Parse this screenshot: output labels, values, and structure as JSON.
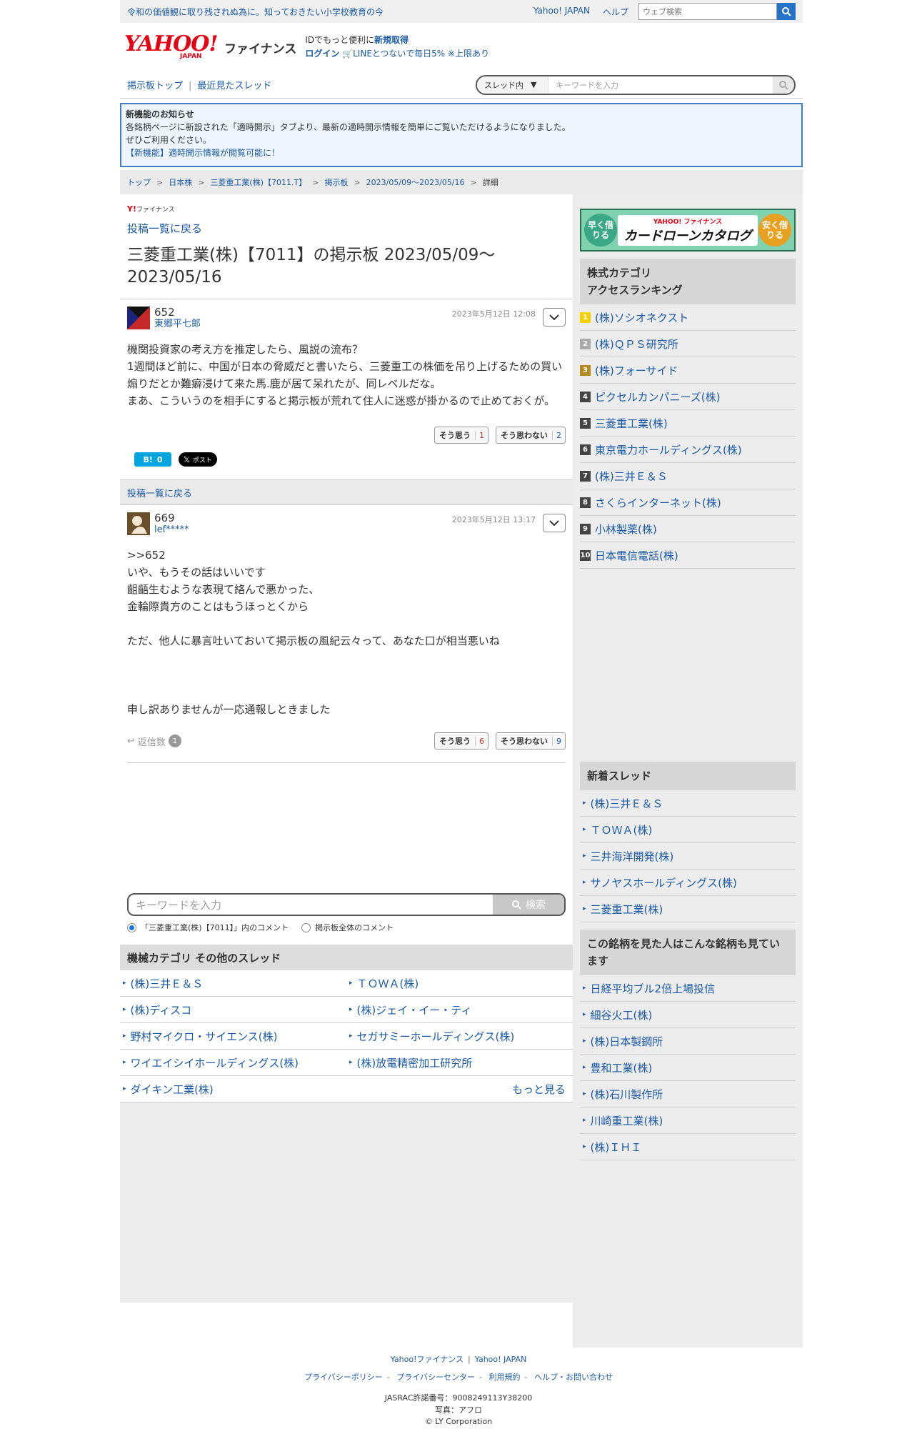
{
  "topbar": {
    "promo": "令和の価値観に取り残されぬ為に。知っておきたい小学校教育の今",
    "links": [
      "Yahoo! JAPAN",
      "ヘルプ"
    ],
    "search_placeholder": "ウェブ検索"
  },
  "header": {
    "logo_main": "YAHOO!",
    "logo_sub": "JAPAN",
    "finance": "ファイナンス",
    "line1_prefix": "IDでもっと便利に",
    "line1_link": "新規取得",
    "login": "ログイン",
    "line2": "LINEとつないで毎日5% ※上限あり"
  },
  "nav": {
    "top": "掲示板トップ",
    "recent": "最近見たスレッド",
    "scope": "スレッド内",
    "placeholder": "キーワードを入力"
  },
  "notice": {
    "title": "新機能のお知らせ",
    "line1": "各銘柄ページに新設された「適時開示」タブより、最新の適時開示情報を簡単にご覧いただけるようになりました。",
    "line2": "ぜひご利用ください。",
    "link": "【新機能】適時開示情報が閲覧可能に！"
  },
  "breadcrumb": [
    "トップ",
    "日本株",
    "三菱重工業(株)【7011.T】",
    "掲示板",
    "2023/05/09〜2023/05/16",
    "詳細"
  ],
  "main": {
    "brand_small": "ファイナンス",
    "back": "投稿一覧に戻る",
    "title": "三菱重工業(株)【7011】の掲示板 2023/05/09〜2023/05/16",
    "posts": [
      {
        "num": "652",
        "user": "東郷平七郎",
        "date": "2023年5月12日 12:08",
        "body": "機関投資家の考え方を推定したら、風説の流布？\n1週間ほど前に、中国が日本の脅威だと書いたら、三菱重工の株価を吊り上げるための買い煽りだとか難癖浸けて来た馬.鹿が居て呆れたが、同レベルだな。\nまあ、こういうのを相手にすると掲示板が荒れて住人に迷惑が掛かるので止めておくが。",
        "agree": "そう思う",
        "agree_count": "1",
        "disagree": "そう思わない",
        "disagree_count": "2"
      },
      {
        "num": "669",
        "user": "lef*****",
        "date": "2023年5月12日 13:17",
        "body": ">>652\nいや、もうその話はいいです\n齟齬生むような表現て絡んで悪かった、\n金輪際貴方のことはもうほっとくから\n\nただ、他人に暴言吐いておいて掲示板の風紀云々って、あなた口が相当悪いね\n\n\n\n申し訳ありませんが一応通報しときました",
        "agree": "そう思う",
        "agree_count": "6",
        "disagree": "そう思わない",
        "disagree_count": "9",
        "reply_label": "返信数",
        "reply_count": "1"
      }
    ],
    "hatena_count": "0",
    "x_label": "ポスト",
    "keyword_placeholder": "キーワードを入力",
    "search_button": "検索",
    "radio1": "「三菱重工業(株)【7011】」内のコメント",
    "radio2": "掲示板全体のコメント",
    "category_title": "機械カテゴリ その他のスレッド",
    "category_items": [
      "(株)三井Ｅ＆Ｓ",
      "ＴＯＷＡ(株)",
      "(株)ディスコ",
      "(株)ジェイ・イー・ティ",
      "野村マイクロ・サイエンス(株)",
      "セガサミーホールディングス(株)",
      "ワイエイシイホールディングス(株)",
      "(株)放電精密加工研究所",
      "ダイキン工業(株)"
    ],
    "more": "もっと見る"
  },
  "side": {
    "banner_left": "早く借りる",
    "banner_brand": "YAHOO! ファイナンス",
    "banner_title": "カードローンカタログ",
    "banner_right": "安く借りる",
    "ranking_title": "株式カテゴリ\nアクセスランキング",
    "ranking": [
      "(株)ソシオネクスト",
      "(株)ＱＰＳ研究所",
      "(株)フォーサイド",
      "ピクセルカンパニーズ(株)",
      "三菱重工業(株)",
      "東京電力ホールディングス(株)",
      "(株)三井Ｅ＆Ｓ",
      "さくらインターネット(株)",
      "小林製薬(株)",
      "日本電信電話(株)"
    ],
    "new_title": "新着スレッド",
    "new_threads": [
      "(株)三井Ｅ＆Ｓ",
      "ＴＯＷＡ(株)",
      "三井海洋開発(株)",
      "サノヤスホールディングス(株)",
      "三菱重工業(株)"
    ],
    "also_title": "この銘柄を見た人はこんな銘柄も見ています",
    "also": [
      "日経平均ブル2倍上場投信",
      "細谷火工(株)",
      "(株)日本製鋼所",
      "豊和工業(株)",
      "(株)石川製作所",
      "川崎重工業(株)",
      "(株)ＩＨＩ"
    ]
  },
  "footer": {
    "row1": [
      "Yahoo!ファイナンス",
      "Yahoo! JAPAN"
    ],
    "row2": [
      "プライバシーポリシー",
      "プライバシーセンター",
      "利用規約",
      "ヘルプ・お問い合わせ"
    ],
    "jasrac": "JASRAC許諾番号：9008249113Y38200",
    "photo": "写真：アフロ",
    "copyright": "© LY Corporation"
  },
  "colors": {
    "link": "#1a5aa6",
    "brand": "#e60012",
    "accent": "#2573c9"
  }
}
